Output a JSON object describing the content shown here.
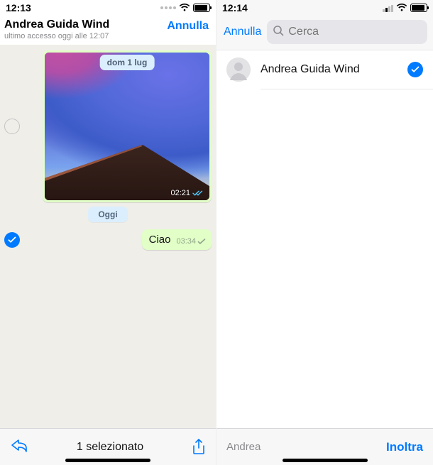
{
  "left": {
    "status": {
      "time": "12:13",
      "batteryPct": 92
    },
    "header": {
      "title": "Andrea Guida Wind",
      "subtitle": "ultimo accesso oggi alle 12:07",
      "cancel": "Annulla"
    },
    "dateChip1": "dom 1 lug",
    "imageMsg": {
      "time": "02:21",
      "read": true,
      "selected": false
    },
    "daySep": "Oggi",
    "textMsg": {
      "text": "Ciao",
      "time": "03:34",
      "delivered": true,
      "selected": true
    },
    "bottom": {
      "countLabel": "1 selezionato"
    }
  },
  "right": {
    "status": {
      "time": "12:14",
      "batteryPct": 92
    },
    "header": {
      "cancel": "Annulla",
      "searchPlaceholder": "Cerca"
    },
    "contact": {
      "name": "Andrea Guida Wind",
      "selected": true
    },
    "bottom": {
      "name": "Andrea",
      "action": "Inoltra"
    }
  }
}
